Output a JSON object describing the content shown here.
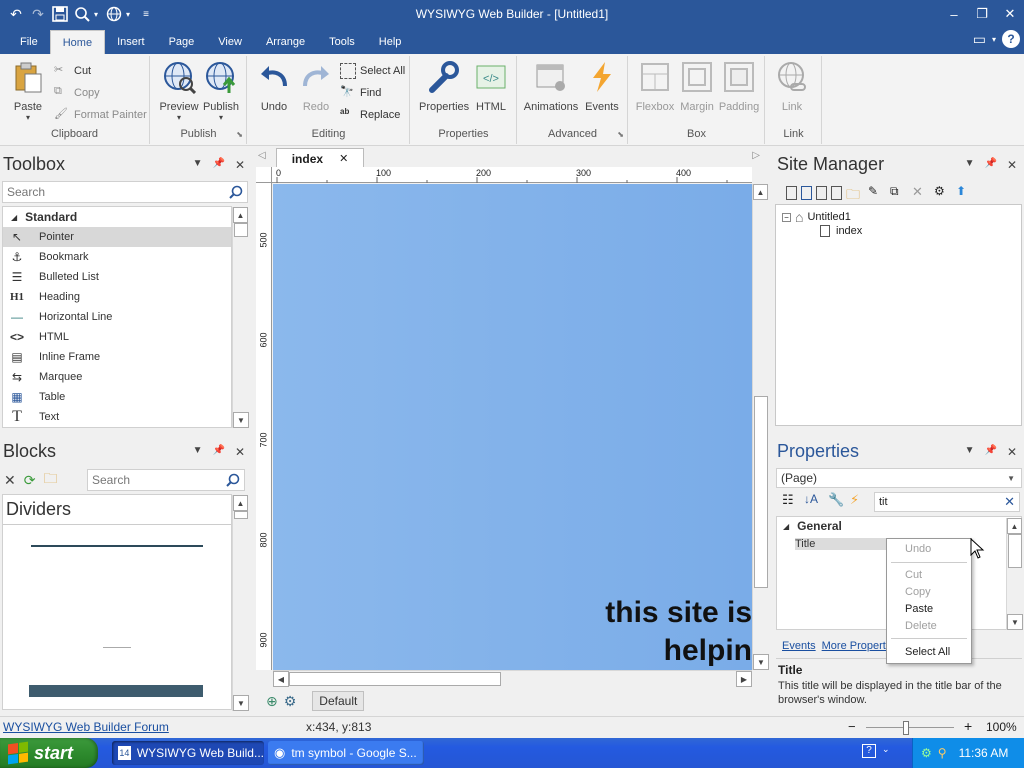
{
  "window": {
    "title": "WYSIWYG Web Builder - [Untitled1]"
  },
  "menu_tabs": [
    "File",
    "Home",
    "Insert",
    "Page",
    "View",
    "Arrange",
    "Tools",
    "Help"
  ],
  "ribbon": {
    "clipboard": {
      "label": "Clipboard",
      "paste": "Paste",
      "cut": "Cut",
      "copy": "Copy",
      "format_painter": "Format Painter"
    },
    "publish": {
      "label": "Publish",
      "preview": "Preview",
      "publish": "Publish"
    },
    "editing": {
      "label": "Editing",
      "undo": "Undo",
      "redo": "Redo",
      "select_all": "Select All",
      "find": "Find",
      "replace": "Replace"
    },
    "properties": {
      "label": "Properties",
      "properties": "Properties",
      "html": "HTML"
    },
    "advanced": {
      "label": "Advanced",
      "animations": "Animations",
      "events": "Events"
    },
    "box": {
      "label": "Box",
      "flexbox": "Flexbox",
      "margin": "Margin",
      "padding": "Padding"
    },
    "link": {
      "label": "Link",
      "link": "Link"
    }
  },
  "toolbox": {
    "title": "Toolbox",
    "search_placeholder": "Search",
    "category": "Standard",
    "items": [
      {
        "label": "Pointer",
        "icon": "pointer-icon",
        "glyph": "↖"
      },
      {
        "label": "Bookmark",
        "icon": "anchor-icon",
        "glyph": "⚓"
      },
      {
        "label": "Bulleted List",
        "icon": "bulleted-list-icon",
        "glyph": "☰"
      },
      {
        "label": "Heading",
        "icon": "heading-icon",
        "glyph": "H1"
      },
      {
        "label": "Horizontal Line",
        "icon": "horizontal-line-icon",
        "glyph": "—"
      },
      {
        "label": "HTML",
        "icon": "code-icon",
        "glyph": "<>"
      },
      {
        "label": "Inline Frame",
        "icon": "inline-frame-icon",
        "glyph": "▤"
      },
      {
        "label": "Marquee",
        "icon": "marquee-icon",
        "glyph": "⇆"
      },
      {
        "label": "Table",
        "icon": "table-icon",
        "glyph": "▦"
      },
      {
        "label": "Text",
        "icon": "text-icon",
        "glyph": "T"
      }
    ]
  },
  "blocks": {
    "title": "Blocks",
    "search_placeholder": "Search",
    "section": "Dividers"
  },
  "editor": {
    "tab": "index",
    "ruler_h": [
      "0",
      "100",
      "200",
      "300",
      "400"
    ],
    "ruler_v": [
      "500",
      "600",
      "700",
      "800",
      "900"
    ],
    "canvas_line1": "this site is",
    "canvas_line2": "helpin",
    "canvas_color": "#7fb0ea",
    "breakpoint": "Default"
  },
  "site_manager": {
    "title": "Site Manager",
    "root": "Untitled1",
    "page": "index"
  },
  "properties_panel": {
    "title": "Properties",
    "object": "(Page)",
    "search_value": "tit",
    "category": "General",
    "row_label": "Title",
    "events_link": "Events",
    "more_link": "More Properti",
    "desc_title": "Title",
    "desc_text": "This title will be displayed in the title bar of the browser's window."
  },
  "context_menu": {
    "undo": "Undo",
    "cut": "Cut",
    "copy": "Copy",
    "paste": "Paste",
    "delete": "Delete",
    "select_all": "Select All"
  },
  "statusbar": {
    "forum": "WYSIWYG Web Builder Forum",
    "coords": "x:434, y:813",
    "zoom": "100%",
    "zoom_level": 1.0
  },
  "taskbar": {
    "start": "start",
    "task1": "WYSIWYG Web Build...",
    "task2": "tm symbol - Google S...",
    "time": "11:36 AM"
  },
  "colors": {
    "accent": "#2b579a",
    "taskbar": "#245ae0",
    "start": "#2e8b2e"
  }
}
